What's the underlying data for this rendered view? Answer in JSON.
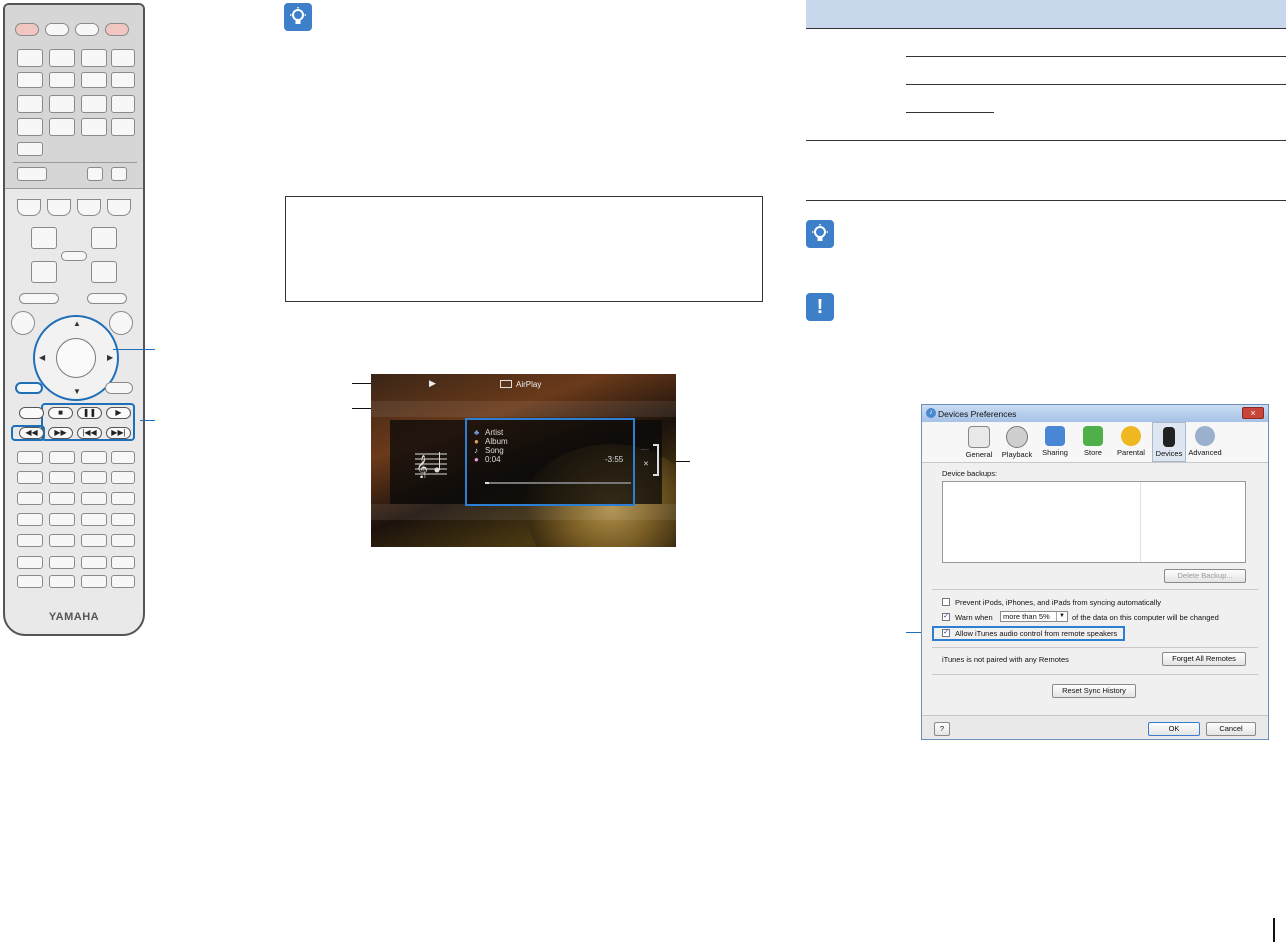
{
  "tv_screen": {
    "source_label": "AirPlay",
    "play_symbol": "▶",
    "artist_label": "Artist",
    "album_label": "Album",
    "song_label": "Song",
    "elapsed": "0:04",
    "remaining": "-3:55",
    "progress_fraction": 0.03
  },
  "remote": {
    "brand": "YAMAHA"
  },
  "itunes_dialog": {
    "title": "Devices Preferences",
    "close_glyph": "×",
    "tabs": [
      "General",
      "Playback",
      "Sharing",
      "Store",
      "Parental",
      "Devices",
      "Advanced"
    ],
    "selected_tab": "Devices",
    "device_backups_label": "Device backups:",
    "delete_backup_button": "Delete Backup...",
    "prevent_sync_label": "Prevent iPods, iPhones, and iPads from syncing automatically",
    "warn_when_label": "Warn when",
    "warn_threshold_value": "more than 5%",
    "warn_suffix_label": "of the data on this computer will be changed",
    "allow_remote_label": "Allow iTunes audio control from remote speakers",
    "not_paired_label": "iTunes is not paired with any Remotes",
    "forget_remotes_button": "Forget All Remotes",
    "reset_sync_button": "Reset Sync History",
    "help_button": "?",
    "ok_button": "OK",
    "cancel_button": "Cancel",
    "checked_glyph": "✓"
  },
  "colors": {
    "accent_blue": "#1f6fb8",
    "table_header": "#c9d7ec",
    "icon_blue": "#3d7fc9"
  }
}
